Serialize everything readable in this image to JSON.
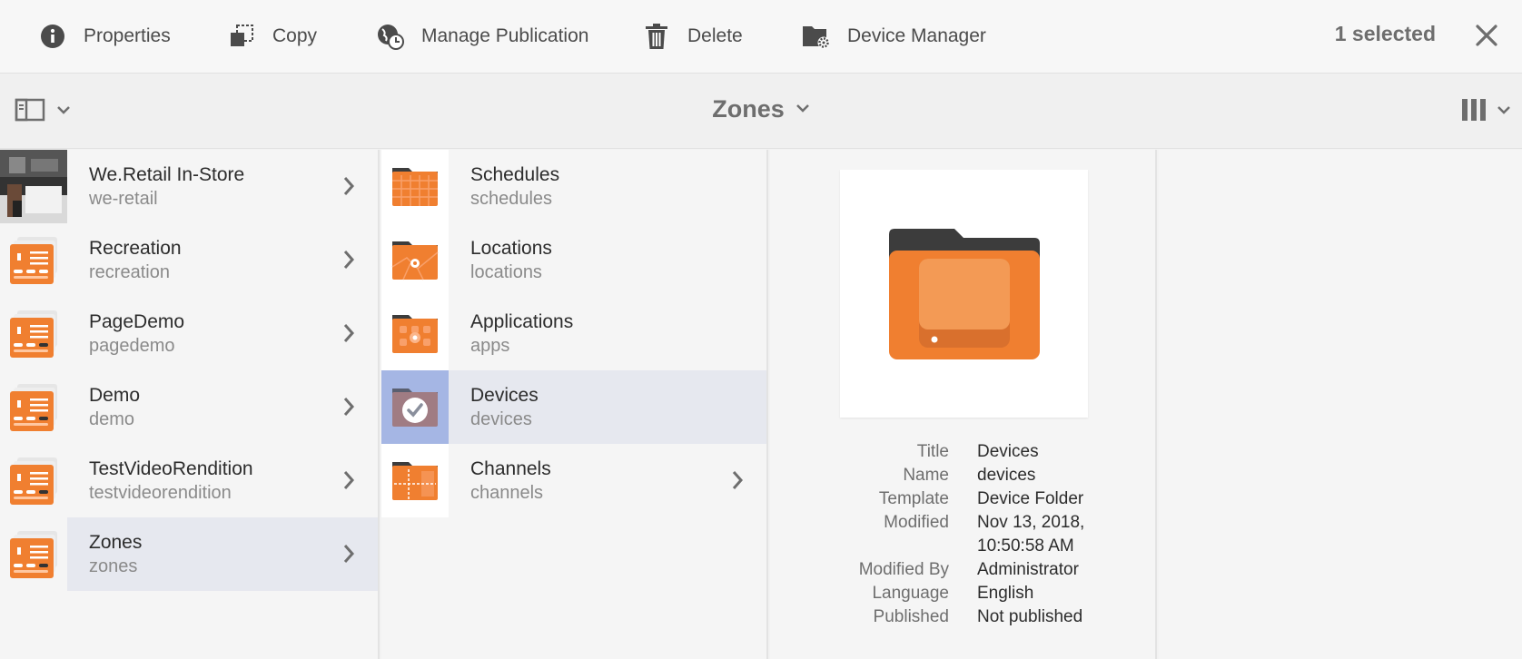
{
  "actionbar": {
    "properties_label": "Properties",
    "copy_label": "Copy",
    "manage_publication_label": "Manage Publication",
    "delete_label": "Delete",
    "device_manager_label": "Device Manager",
    "selection_count": "1 selected"
  },
  "header": {
    "title": "Zones"
  },
  "column1": [
    {
      "title": "We.Retail In-Store",
      "name": "we-retail",
      "thumb": "photo"
    },
    {
      "title": "Recreation",
      "name": "recreation",
      "thumb": "project-icon"
    },
    {
      "title": "PageDemo",
      "name": "pagedemo",
      "thumb": "project-icon"
    },
    {
      "title": "Demo",
      "name": "demo",
      "thumb": "project-icon"
    },
    {
      "title": "TestVideoRendition",
      "name": "testvideorendition",
      "thumb": "project-icon"
    },
    {
      "title": "Zones",
      "name": "zones",
      "thumb": "project-icon"
    }
  ],
  "column2": [
    {
      "title": "Schedules",
      "name": "schedules",
      "icon": "schedules-folder-icon"
    },
    {
      "title": "Locations",
      "name": "locations",
      "icon": "locations-folder-icon"
    },
    {
      "title": "Applications",
      "name": "apps",
      "icon": "applications-folder-icon"
    },
    {
      "title": "Devices",
      "name": "devices",
      "icon": "devices-folder-icon"
    },
    {
      "title": "Channels",
      "name": "channels",
      "icon": "channels-folder-icon"
    }
  ],
  "details": {
    "title_label": "Title",
    "title_value": "Devices",
    "name_label": "Name",
    "name_value": "devices",
    "template_label": "Template",
    "template_value": "Device Folder",
    "modified_label": "Modified",
    "modified_value": "Nov 13, 2018, 10:50:58 AM",
    "modified_by_label": "Modified By",
    "modified_by_value": "Administrator",
    "language_label": "Language",
    "language_value": "English",
    "published_label": "Published",
    "published_value": "Not published"
  },
  "colors": {
    "orange": "#f07f30",
    "dark": "#3c3c3c",
    "selected_row": "#e6e8ef",
    "selected_thumb": "#a5b6e4"
  }
}
